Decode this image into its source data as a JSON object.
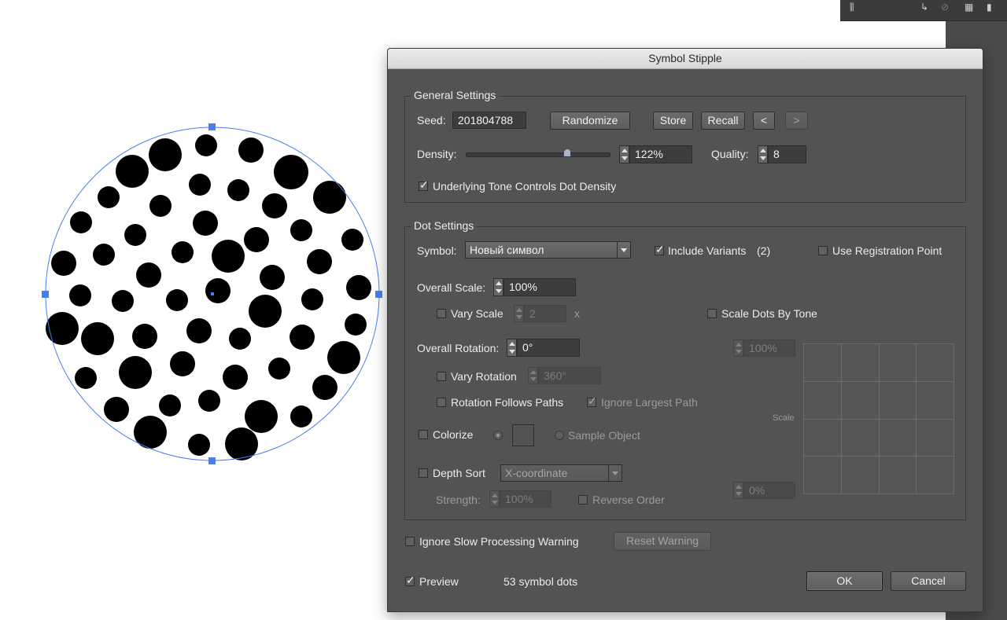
{
  "dialog": {
    "title": "Symbol Stipple"
  },
  "general": {
    "legend": "General Settings",
    "seed_label": "Seed:",
    "seed_value": "201804788",
    "randomize": "Randomize",
    "store": "Store",
    "recall": "Recall",
    "prev": "<",
    "next": ">",
    "density_label": "Density:",
    "density_value": "122%",
    "density_fraction": 0.71,
    "quality_label": "Quality:",
    "quality_value": "8",
    "tone_label": "Underlying Tone Controls Dot Density",
    "tone_checked": true
  },
  "dot": {
    "legend": "Dot Settings",
    "symbol_label": "Symbol:",
    "symbol_value": "Новый символ",
    "include_variants": "Include Variants",
    "variants_count": "(2)",
    "use_registration": "Use Registration Point",
    "overall_scale_label": "Overall Scale:",
    "overall_scale_value": "100%",
    "vary_scale": "Vary Scale",
    "vary_scale_value": "2",
    "vary_scale_unit": "x",
    "scale_by_tone": "Scale Dots By Tone",
    "overall_rotation_label": "Overall Rotation:",
    "overall_rotation_value": "0°",
    "vary_rotation": "Vary Rotation",
    "vary_rotation_value": "360°",
    "rotation_follows": "Rotation Follows Paths",
    "ignore_largest": "Ignore Largest Path",
    "colorize": "Colorize",
    "sample_object": "Sample Object",
    "depth_sort": "Depth Sort",
    "depth_sort_value": "X-coordinate",
    "strength_label": "Strength:",
    "strength_value": "100%",
    "reverse_order": "Reverse Order",
    "graph_top_value": "100%",
    "graph_bottom_value": "0%",
    "graph_axis_label": "Scale"
  },
  "bottom": {
    "ignore_warning": "Ignore Slow Processing Warning",
    "reset_warning": "Reset Warning",
    "preview": "Preview",
    "dot_count": "53 symbol dots",
    "ok": "OK",
    "cancel": "Cancel"
  },
  "colors": {
    "dialog_bg": "#535353",
    "selection_blue": "#4a7ef0",
    "dot_fill": "#000000"
  },
  "icons": {
    "top_panel": [
      "library-icon",
      "arrow-icon",
      "unlink-icon",
      "table-icon",
      "document-icon"
    ]
  }
}
